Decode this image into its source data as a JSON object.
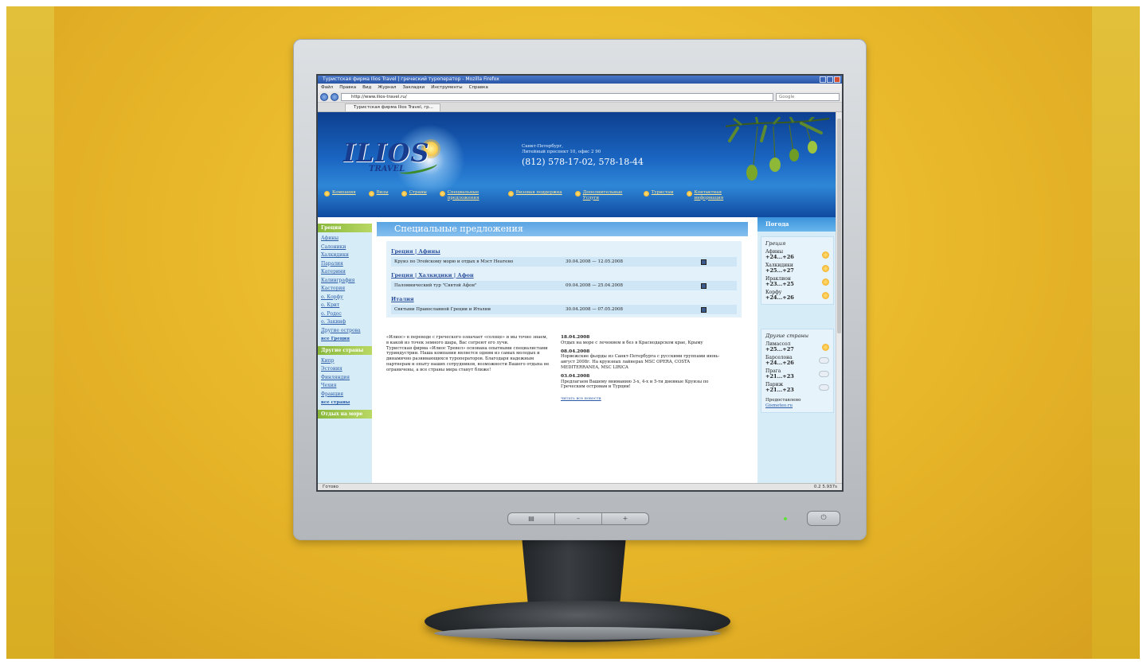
{
  "browser": {
    "window_title": "Туристская фирма Ilios Travel | греческий туроператор - Mozilla Firefox",
    "menu": [
      "Файл",
      "Правка",
      "Вид",
      "Журнал",
      "Закладки",
      "Инструменты",
      "Справка"
    ],
    "url": "http://www.ilios-travel.ru/",
    "search_placeholder": "Google",
    "tab_title": "Туристская фирма Ilios Travel, гр...",
    "status_text": "Готово",
    "status_right": "0.2  5.937s"
  },
  "site": {
    "logo": "ILIOS",
    "logo_sub": "TRAVEL",
    "contact": {
      "city": "Санкт-Петербург,",
      "address": "Литейный проспект 10, офис 2 90",
      "phone": "(812) 578-17-02, 578-18-44"
    },
    "nav": [
      "Компания",
      "Визы",
      "Страны",
      "Специальные предложения",
      "Визовая поддержка",
      "Дополнительные Услуги",
      "Туристам",
      "Контактная информация"
    ]
  },
  "left_sidebar": {
    "greece_header": "Греция",
    "greece_links": [
      "Афины",
      "Салоники",
      "Халкидики",
      "Паралия Катерини",
      "Каливграфия",
      "Кастория",
      "о. Корфу",
      "о. Крит",
      "о. Родос",
      "о. Закинф",
      "Другие острова"
    ],
    "greece_all": "все Греция",
    "other_header": "Другие страны",
    "other_links": [
      "Кипр",
      "Эстония",
      "Финляндия",
      "Чехия",
      "Франция"
    ],
    "other_all": "все страны",
    "next_header": "Отдых на море"
  },
  "main": {
    "title": "Специальные предложения",
    "groups": [
      {
        "heading": "Греция | Афины",
        "rows": [
          {
            "name": "Круиз по Эгейскому морю и отдых в Мэст Неатено",
            "dates": "30.04.2008 — 12.05.2008"
          }
        ]
      },
      {
        "heading": "Греция | Халкидики | Афон",
        "rows": [
          {
            "name": "Паломнический тур \"Святой Афон\"",
            "dates": "09.04.2008 — 25.04.2008"
          }
        ]
      },
      {
        "heading": "Италия",
        "rows": [
          {
            "name": "Святыни Православной Греции и Италии",
            "dates": "30.04.2008 — 07.05.2008"
          }
        ]
      }
    ],
    "about": "«Илиос» в переводе с греческого означает «солнце» и мы точно знаем, в какой из точек земного шара, Вас согреют его лучи.\nТуристская фирма «Илиос Тревел» основана опытными специалистами туриндустрии. Наша компания является одним из самых молодых и динамично развивающихся туроператоров. Благодаря надежным партнерам и опыту наших сотрудников, возможности Вашего отдыха не ограничены, а все страны мира станут ближе!",
    "news": [
      {
        "date": "18.04.2008",
        "text": "Отдых на море с лечением и без в Краснодарском крае, Крыму"
      },
      {
        "date": "08.04.2008",
        "text": "Норвежские фьорды из Санкт-Петербурга с русскими группами июнь-август 2008г. На круизных лайнерах MSC OPERA, COSTA MEDITERRANEA, MSC LIRICA"
      },
      {
        "date": "03.04.2008",
        "text": "Предлагаем Вашему вниманию 3-х, 4-х и 5-ти дневные Круизы по Греческим островам и Турции!"
      }
    ],
    "all_news": "читать все новости"
  },
  "weather": {
    "header": "Погода",
    "greece_label": "Греция",
    "greece": [
      {
        "city": "Афины",
        "temp": "+24...+26",
        "icon": "sun"
      },
      {
        "city": "Халкидики",
        "temp": "+25...+27",
        "icon": "sun"
      },
      {
        "city": "Ираклион",
        "temp": "+23...+25",
        "icon": "sun"
      },
      {
        "city": "Корфу",
        "temp": "+24...+26",
        "icon": "sun"
      }
    ],
    "other_label": "Другие страны",
    "other": [
      {
        "city": "Лимассол",
        "temp": "+25...+27",
        "icon": "sun"
      },
      {
        "city": "Барселона",
        "temp": "+24...+26",
        "icon": "partly-cloudy"
      },
      {
        "city": "Прага",
        "temp": "+21...+23",
        "icon": "partly-cloudy"
      },
      {
        "city": "Париж",
        "temp": "+21...+23",
        "icon": "partly-cloudy"
      }
    ],
    "provided_label": "Предоставлено",
    "provided_link": "Gismeteo.ru"
  }
}
